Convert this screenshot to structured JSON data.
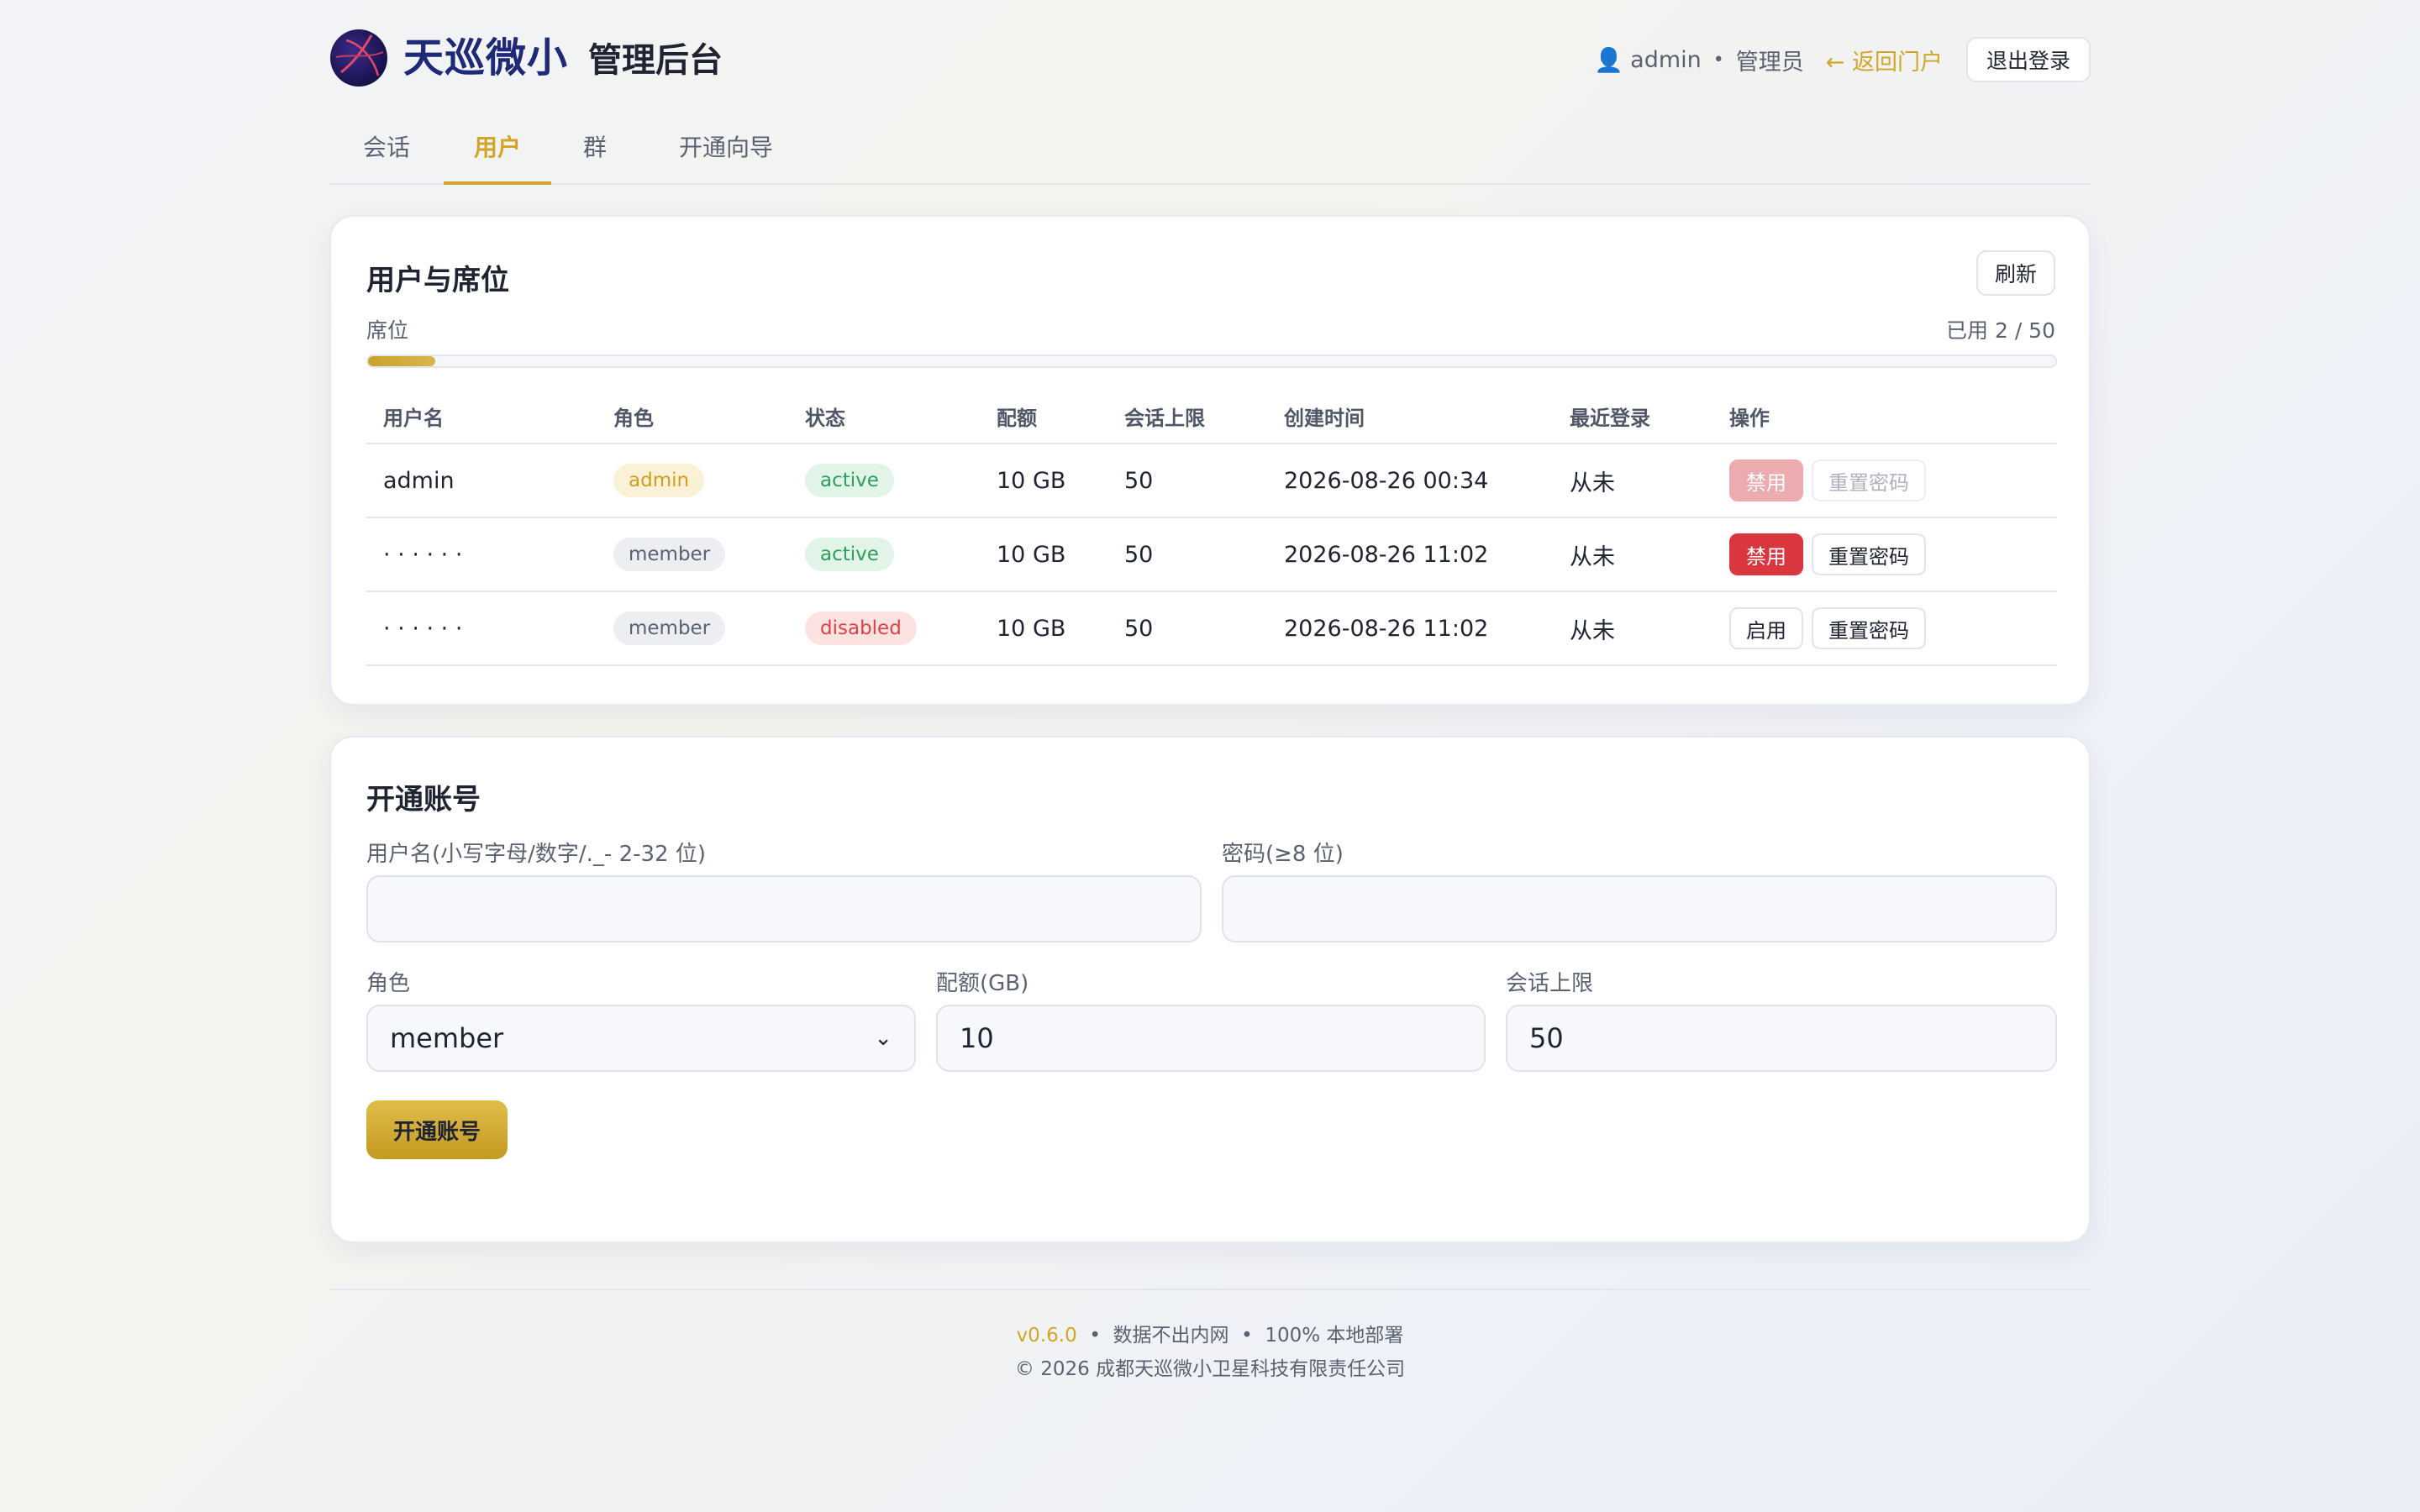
{
  "header": {
    "brand": "天巡微小",
    "console_title": "管理后台",
    "user_icon": "👤",
    "username": "admin",
    "separator": "•",
    "role": "管理员",
    "back_label": "← 返回门户",
    "logout_label": "退出登录"
  },
  "tabs": [
    {
      "label": "会话",
      "active": false
    },
    {
      "label": "用户",
      "active": true
    },
    {
      "label": "群",
      "active": false
    },
    {
      "label": "开通向导",
      "active": false
    }
  ],
  "users_card": {
    "title": "用户与席位",
    "refresh_label": "刷新",
    "seat_label": "席位",
    "seat_used_text": "已用 2 / 50",
    "seat_fraction": 0.04,
    "columns": [
      "用户名",
      "角色",
      "状态",
      "配额",
      "会话上限",
      "创建时间",
      "最近登录",
      "操作"
    ],
    "rows": [
      {
        "username": "admin",
        "role": "admin",
        "status": "active",
        "quota": "10 GB",
        "session_limit": "50",
        "created": "2026-08-26 00:34",
        "last_login": "从未",
        "toggle_label": "禁用",
        "reset_label": "重置密码"
      },
      {
        "username": "· · · · · ·",
        "role": "member",
        "status": "active",
        "quota": "10 GB",
        "session_limit": "50",
        "created": "2026-08-26 11:02",
        "last_login": "从未",
        "toggle_label": "禁用",
        "reset_label": "重置密码"
      },
      {
        "username": "· · · · · ·",
        "role": "member",
        "status": "disabled",
        "quota": "10 GB",
        "session_limit": "50",
        "created": "2026-08-26 11:02",
        "last_login": "从未",
        "toggle_label": "启用",
        "reset_label": "重置密码"
      }
    ]
  },
  "create_card": {
    "title": "开通账号",
    "username_label": "用户名(小写字母/数字/._- 2-32 位)",
    "username_value": "",
    "password_label": "密码(≥8 位)",
    "password_value": "",
    "role_label": "角色",
    "role_value": "member",
    "quota_label": "配额(GB)",
    "quota_value": "10",
    "session_limit_label": "会话上限",
    "session_limit_value": "50",
    "submit_label": "开通账号"
  },
  "footer": {
    "version": "v0.6.0",
    "sep": "•",
    "note1": "数据不出内网",
    "note2": "100% 本地部署",
    "copyright": "© 2026 成都天巡微小卫星科技有限责任公司"
  },
  "colors": {
    "accent": "#d3a526",
    "brand": "#1e2a78",
    "danger": "#d9363e",
    "success": "#2e9e5b"
  }
}
